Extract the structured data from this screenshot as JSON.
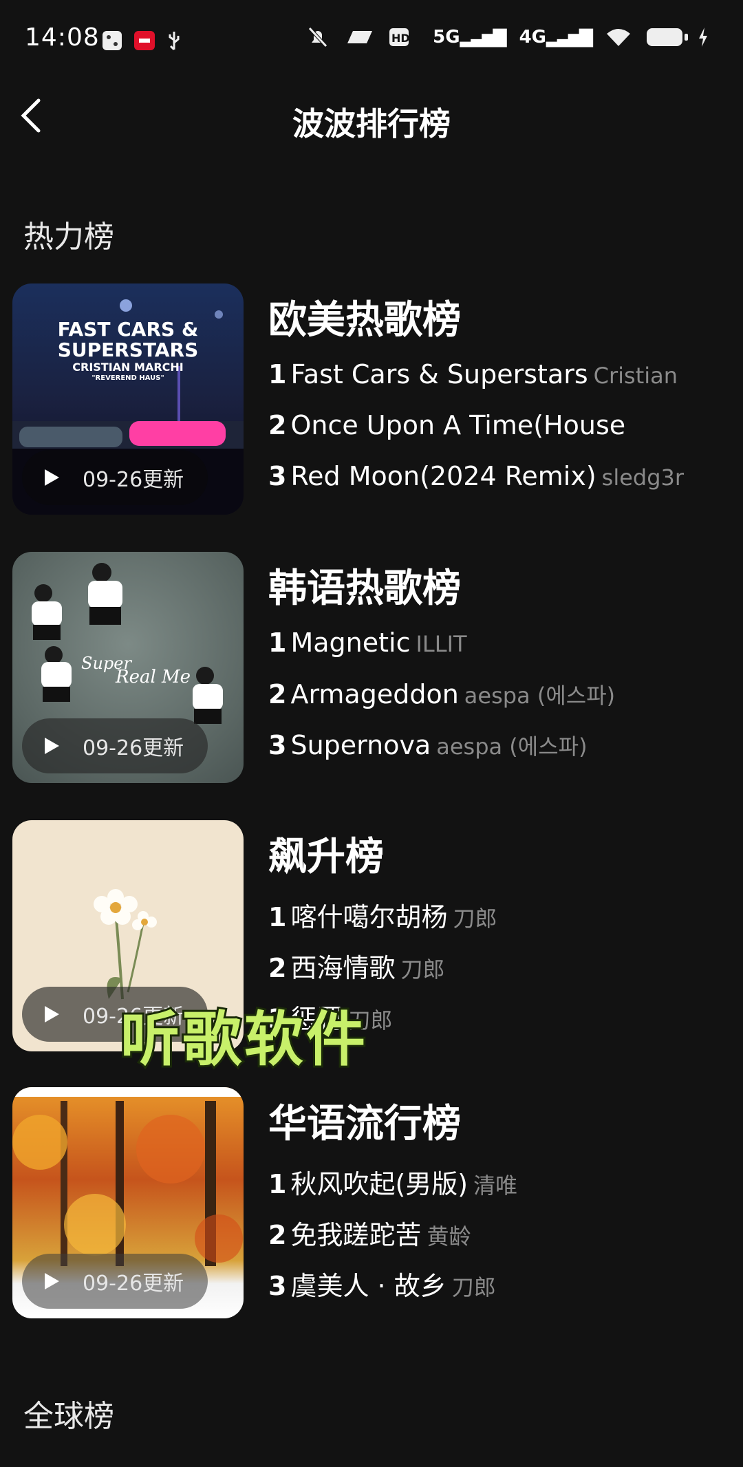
{
  "status": {
    "time": "14:08",
    "signals": [
      "5G",
      "4G"
    ]
  },
  "header": {
    "title": "波波排行榜"
  },
  "sections": {
    "hot": "热力榜",
    "global": "全球榜"
  },
  "charts": [
    {
      "name": "欧美热歌榜",
      "update": "09-26更新",
      "songs": [
        {
          "rank": "1",
          "title": "Fast Cars & Superstars",
          "artist": "Cristian"
        },
        {
          "rank": "2",
          "title": "Once Upon A Time(House",
          "artist": ""
        },
        {
          "rank": "3",
          "title": "Red Moon(2024 Remix)",
          "artist": "sledg3r"
        }
      ],
      "cover_text": {
        "line1": "FAST CARS &",
        "line2": "SUPERSTARS",
        "line3": "CRISTIAN MARCHI",
        "line4": "\"REVEREND HAUS\""
      }
    },
    {
      "name": "韩语热歌榜",
      "update": "09-26更新",
      "songs": [
        {
          "rank": "1",
          "title": "Magnetic",
          "artist": "ILLIT"
        },
        {
          "rank": "2",
          "title": "Armageddon",
          "artist": "aespa (에스파)"
        },
        {
          "rank": "3",
          "title": "Supernova",
          "artist": "aespa (에스파)"
        }
      ]
    },
    {
      "name": "飙升榜",
      "update": "09-26更新",
      "songs": [
        {
          "rank": "1",
          "title": "喀什噶尔胡杨",
          "artist": "刀郎"
        },
        {
          "rank": "2",
          "title": "西海情歌",
          "artist": "刀郎"
        },
        {
          "rank": "3",
          "title": "惩罚",
          "artist": "刀郎"
        }
      ]
    },
    {
      "name": "华语流行榜",
      "update": "09-26更新",
      "songs": [
        {
          "rank": "1",
          "title": "秋风吹起(男版)",
          "artist": "清唯"
        },
        {
          "rank": "2",
          "title": "免我蹉跎苦",
          "artist": "黄龄"
        },
        {
          "rank": "3",
          "title": "虞美人 · 故乡",
          "artist": "刀郎"
        }
      ]
    }
  ],
  "overlay_caption": "听歌软件",
  "colors": {
    "background": "#121212",
    "caption": "#c8f06a",
    "secondary_text": "#8a8a8a"
  }
}
